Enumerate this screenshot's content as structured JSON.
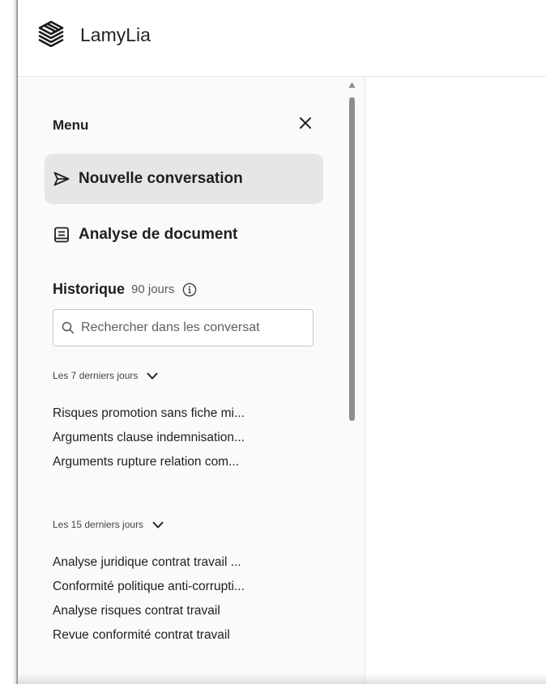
{
  "app": {
    "title": "LamyLia",
    "logo_icon": "layers-logo-icon"
  },
  "menu": {
    "title": "Menu",
    "close_icon": "close-icon",
    "nav": [
      {
        "label": "Nouvelle conversation",
        "icon": "send-icon",
        "active": true
      },
      {
        "label": "Analyse de document",
        "icon": "document-icon",
        "active": false
      }
    ]
  },
  "history": {
    "title": "Historique",
    "days": "90 jours",
    "info_icon": "info-icon",
    "search": {
      "placeholder": "Rechercher dans les conversat",
      "value": ""
    },
    "groups": [
      {
        "label": "Les 7 derniers jours",
        "items": [
          "Risques promotion sans fiche mi...",
          "Arguments clause indemnisation...",
          "Arguments rupture relation com..."
        ]
      },
      {
        "label": "Les 15 derniers jours",
        "items": [
          "Analyse juridique contrat travail ...",
          "Conformité politique anti-corrupti...",
          "Analyse risques contrat travail",
          "Revue conformité contrat travail"
        ]
      }
    ]
  },
  "colors": {
    "sidebar_bg": "#fafafa",
    "active_bg": "#e6e6e6",
    "text": "#1f1f1f",
    "scroll_thumb": "#8d8d8d"
  }
}
